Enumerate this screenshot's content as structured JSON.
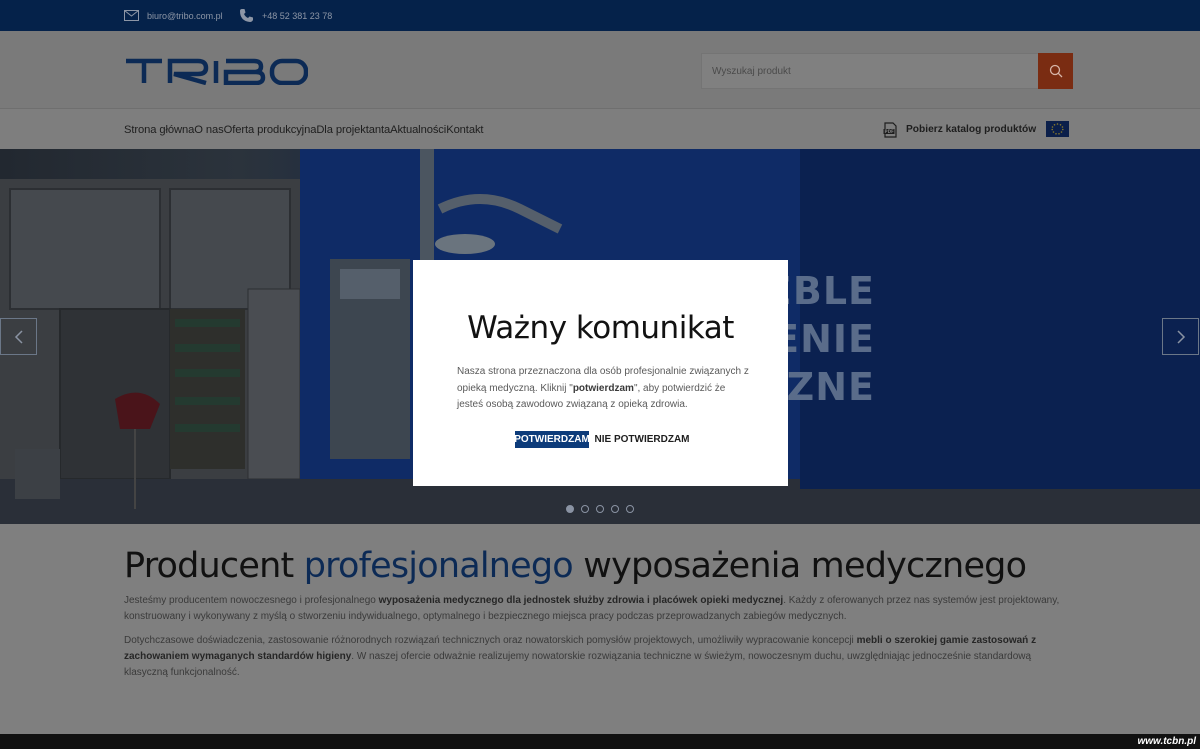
{
  "topbar": {
    "email": "biuro@tribo.com.pl",
    "phone": "+48 52 381 23 78"
  },
  "header": {
    "logo_text": "TRIBO",
    "search_placeholder": "Wyszukaj produkt"
  },
  "nav": {
    "items": [
      "Strona główna",
      "O nas",
      "Oferta produkcyjna",
      "Dla projektanta",
      "Aktualności",
      "Kontakt"
    ],
    "catalog_label": "Pobierz katalog produktów"
  },
  "hero": {
    "lines": [
      "EBLE",
      "ENIE",
      "CZNE"
    ],
    "slide_count": 5,
    "active_slide": 1
  },
  "content": {
    "headline_prefix": "Producent ",
    "headline_highlight": "profesjonalnego",
    "headline_suffix": " wyposażenia medycznego",
    "p1_a": "Jesteśmy producentem nowoczesnego i profesjonalnego ",
    "p1_b": "wyposażenia medycznego dla jednostek służby zdrowia i placówek opieki medycznej",
    "p1_c": ". Każdy z oferowanych przez nas systemów jest projektowany, konstruowany i wykonywany z myślą o stworzeniu indywidualnego, optymalnego i bezpiecznego miejsca pracy podczas przeprowadzanych zabiegów medycznych.",
    "p2_a": "Dotychczasowe doświadczenia, zastosowanie różnorodnych rozwiązań technicznych oraz nowatorskich pomysłów projektowych, umożliwiły wypracowanie koncepcji ",
    "p2_b": "mebli o szerokiej gamie zastosowań z zachowaniem wymaganych standardów higieny",
    "p2_c": ". W naszej ofercie odważnie realizujemy nowatorskie rozwiązania techniczne w świeżym, nowoczesnym duchu, uwzględniając jednocześnie standardową klasyczną funkcjonalność."
  },
  "modal": {
    "title": "Ważny komunikat",
    "text_a": "Nasza strona przeznaczona dla osób profesjonalnie związanych z opieką medyczną. Kliknij \"",
    "text_b": "potwierdzam",
    "text_c": "\",  aby potwierdzić że jesteś osobą zawodowo związaną z opieką zdrowia.",
    "confirm_label": "POTWIERDZAM",
    "reject_label": "NIE POTWIERDZAM"
  },
  "watermark": "www.tcbn.pl",
  "colors": {
    "navy": "#05224a",
    "accent_orange": "#e05a27",
    "headline_blue": "#0c2a55",
    "confirm_bg": "#0c3b7a"
  },
  "icons": {
    "email": "envelope-icon",
    "phone": "phone-icon",
    "search": "search-icon",
    "catalog": "pdf-icon",
    "language": "eu-flag-icon",
    "prev": "chevron-left-icon",
    "next": "chevron-right-icon"
  }
}
